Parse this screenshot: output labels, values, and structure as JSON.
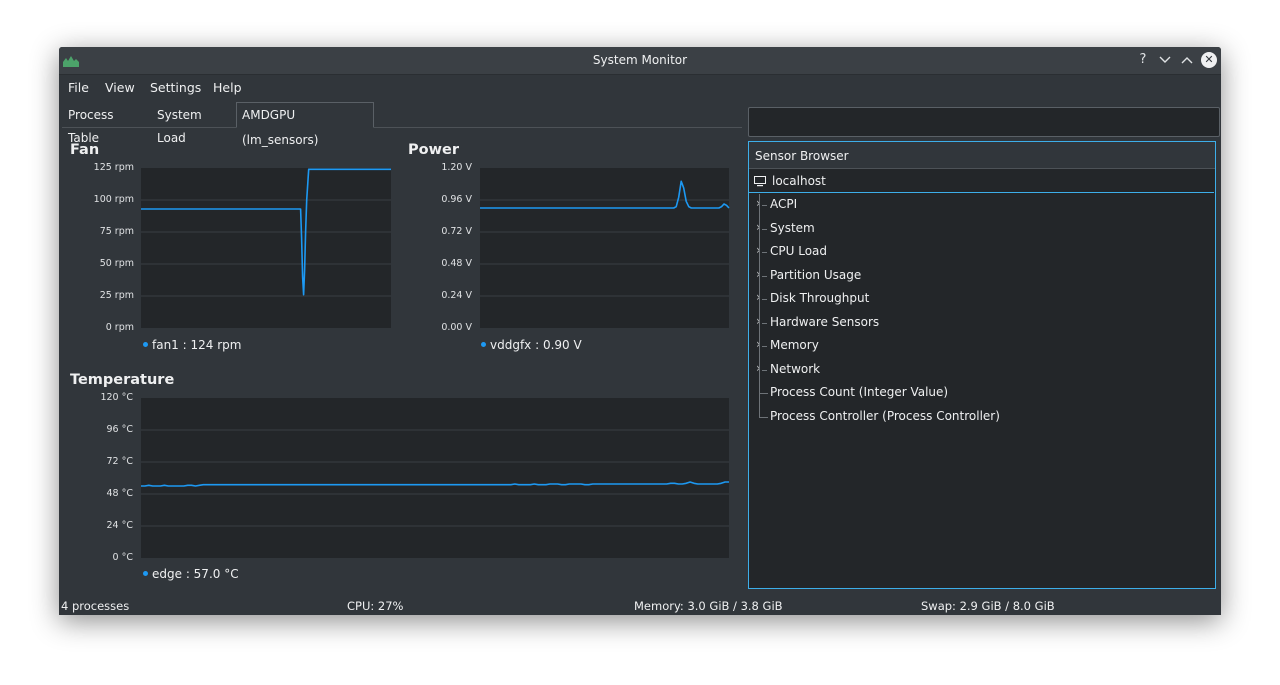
{
  "window": {
    "title": "System Monitor"
  },
  "titlebar_buttons": {
    "help": "?",
    "minimize": "⌄",
    "maximize": "⌃",
    "close": "✕"
  },
  "menu": {
    "file": "File",
    "view": "View",
    "settings": "Settings",
    "help": "Help"
  },
  "tabs": [
    {
      "label": "Process Table",
      "active": false
    },
    {
      "label": "System Load",
      "active": false
    },
    {
      "label": "AMDGPU (lm_sensors)",
      "active": true
    }
  ],
  "search": {
    "value": "",
    "placeholder": ""
  },
  "panels": {
    "fan": {
      "title": "Fan",
      "yticks": [
        "125 rpm",
        "100 rpm",
        "75 rpm",
        "50 rpm",
        "25 rpm",
        "0 rpm"
      ],
      "legend": "fan1 : 124 rpm"
    },
    "power": {
      "title": "Power",
      "yticks": [
        "1.20 V",
        "0.96 V",
        "0.72 V",
        "0.48 V",
        "0.24 V",
        "0.00 V"
      ],
      "legend": "vddgfx : 0.90 V"
    },
    "temperature": {
      "title": "Temperature",
      "yticks": [
        "120 °C",
        "96 °C",
        "72 °C",
        "48 °C",
        "24 °C",
        "0 °C"
      ],
      "legend": "edge : 57.0 °C"
    }
  },
  "chart_data": [
    {
      "type": "line",
      "title": "Fan",
      "ylim": [
        0,
        125
      ],
      "series": [
        {
          "name": "fan1",
          "color": "#1d99f3",
          "values": [
            93,
            93,
            93,
            93,
            93,
            93,
            93,
            93,
            93,
            93,
            93,
            93,
            93,
            93,
            93,
            93,
            93,
            93,
            93,
            93,
            93,
            93,
            93,
            93,
            93,
            93,
            93,
            93,
            93,
            93,
            93,
            93,
            93,
            93,
            93,
            93,
            93,
            93,
            93,
            93,
            93,
            93,
            93,
            93,
            93,
            93,
            93,
            93,
            93,
            93,
            93,
            93,
            93,
            93,
            93,
            93,
            93,
            93,
            93,
            93,
            93,
            93,
            93,
            93,
            93,
            93,
            93,
            93,
            93,
            93,
            93,
            93,
            93,
            93,
            93,
            93,
            93,
            93,
            93,
            93,
            93,
            93,
            93,
            93,
            93,
            93,
            93,
            93,
            93,
            93,
            93,
            93,
            93,
            93,
            93,
            93,
            93,
            93,
            93,
            93,
            93,
            93,
            93,
            93,
            93,
            93,
            93,
            93,
            93,
            93,
            93,
            93,
            93,
            93,
            93,
            93,
            93,
            93,
            93,
            93,
            93,
            93,
            93,
            93,
            93,
            93,
            93,
            93,
            93,
            93,
            93,
            93,
            93,
            93,
            93,
            93,
            93,
            93,
            93,
            93,
            93,
            93,
            93,
            93,
            93,
            93,
            93,
            93,
            93,
            93,
            93,
            93,
            93,
            93,
            93,
            93,
            93,
            93,
            70,
            40,
            26,
            45,
            75,
            100,
            112,
            124,
            124,
            124,
            124,
            124,
            124,
            124,
            124,
            124,
            124,
            124,
            124,
            124,
            124,
            124,
            124,
            124,
            124,
            124,
            124,
            124,
            124,
            124,
            124,
            124,
            124,
            124,
            124,
            124,
            124,
            124,
            124,
            124,
            124,
            124,
            124,
            124,
            124,
            124,
            124,
            124,
            124,
            124,
            124,
            124,
            124,
            124,
            124,
            124,
            124,
            124,
            124,
            124,
            124,
            124,
            124,
            124,
            124,
            124,
            124,
            124,
            124,
            124,
            124,
            124,
            124,
            124,
            124,
            124,
            124,
            124,
            124,
            124,
            124,
            124,
            124,
            124,
            124,
            124,
            124,
            124,
            124
          ]
        }
      ]
    },
    {
      "type": "line",
      "title": "Power",
      "ylim": [
        0,
        1.2
      ],
      "series": [
        {
          "name": "vddgfx",
          "color": "#1d99f3",
          "values": [
            0.9,
            0.9,
            0.9,
            0.9,
            0.9,
            0.9,
            0.9,
            0.9,
            0.9,
            0.9,
            0.9,
            0.9,
            0.9,
            0.9,
            0.9,
            0.9,
            0.9,
            0.9,
            0.9,
            0.9,
            0.9,
            0.9,
            0.9,
            0.9,
            0.9,
            0.9,
            0.9,
            0.9,
            0.9,
            0.9,
            0.9,
            0.9,
            0.9,
            0.9,
            0.9,
            0.9,
            0.9,
            0.9,
            0.9,
            0.9,
            0.9,
            0.9,
            0.9,
            0.9,
            0.9,
            0.9,
            0.9,
            0.9,
            0.9,
            0.9,
            0.9,
            0.9,
            0.9,
            0.9,
            0.9,
            0.9,
            0.9,
            0.9,
            0.9,
            0.9,
            0.9,
            0.9,
            0.9,
            0.9,
            0.9,
            0.9,
            0.9,
            0.9,
            0.9,
            0.9,
            0.9,
            0.9,
            0.9,
            0.9,
            0.9,
            0.9,
            0.9,
            0.9,
            0.91,
            0.98,
            1.1,
            1.05,
            0.95,
            0.91,
            0.9,
            0.9,
            0.9,
            0.9,
            0.9,
            0.9,
            0.9,
            0.9,
            0.9,
            0.9,
            0.9,
            0.9,
            0.91,
            0.93,
            0.92,
            0.9
          ]
        }
      ]
    },
    {
      "type": "line",
      "title": "Temperature",
      "ylim": [
        0,
        120
      ],
      "series": [
        {
          "name": "edge",
          "color": "#1d99f3",
          "values": [
            54,
            54,
            54.5,
            54,
            54,
            54,
            54.5,
            54,
            54,
            54,
            54,
            54,
            54.5,
            54.5,
            54,
            54.5,
            55,
            55,
            55,
            55,
            55,
            55,
            55,
            55,
            55,
            55,
            55,
            55,
            55,
            55,
            55,
            55,
            55,
            55,
            55,
            55,
            55,
            55,
            55,
            55,
            55,
            55,
            55,
            55,
            55,
            55,
            55,
            55,
            55,
            55,
            55,
            55,
            55,
            55,
            55,
            55,
            55,
            55,
            55,
            55,
            55,
            55,
            55,
            55,
            55,
            55,
            55,
            55,
            55,
            55,
            55,
            55,
            55,
            55,
            55,
            55,
            55,
            55,
            55,
            55,
            55,
            55,
            55,
            55,
            55,
            55,
            55,
            55,
            55,
            55,
            55,
            55,
            55,
            55,
            55,
            55,
            55.5,
            55,
            55,
            55,
            55,
            55.5,
            55,
            55,
            55,
            55.5,
            55.5,
            55.5,
            55,
            55,
            55.5,
            55.5,
            55.5,
            55.5,
            55,
            55,
            55.5,
            55.5,
            55.5,
            55.5,
            55.5,
            55.5,
            55.5,
            55.5,
            55.5,
            55.5,
            55.5,
            55.5,
            55.5,
            55.5,
            55.5,
            55.5,
            55.5,
            55.5,
            55.5,
            55.5,
            56,
            56,
            55.5,
            55.5,
            56,
            57,
            56,
            55.5,
            55.5,
            55.5,
            55.5,
            55.5,
            55.5,
            56,
            57,
            57
          ]
        }
      ]
    }
  ],
  "sensor_browser": {
    "header": "Sensor Browser",
    "root": "localhost",
    "items": [
      {
        "label": "ACPI",
        "expandable": true
      },
      {
        "label": "System",
        "expandable": true
      },
      {
        "label": "CPU Load",
        "expandable": true
      },
      {
        "label": "Partition Usage",
        "expandable": true
      },
      {
        "label": "Disk Throughput",
        "expandable": true
      },
      {
        "label": "Hardware Sensors",
        "expandable": true
      },
      {
        "label": "Memory",
        "expandable": true
      },
      {
        "label": "Network",
        "expandable": true
      },
      {
        "label": "Process Count (Integer Value)",
        "expandable": false
      },
      {
        "label": "Process Controller (Process Controller)",
        "expandable": false
      }
    ]
  },
  "statusbar": {
    "processes": "4 processes",
    "cpu": "CPU: 27%",
    "memory": "Memory: 3.0 GiB / 3.8 GiB",
    "swap": "Swap: 2.9 GiB / 8.0 GiB"
  },
  "colors": {
    "accent": "#1d99f3",
    "window_bg": "#31363b",
    "plot_bg": "#232629",
    "focus": "#3daee9"
  }
}
